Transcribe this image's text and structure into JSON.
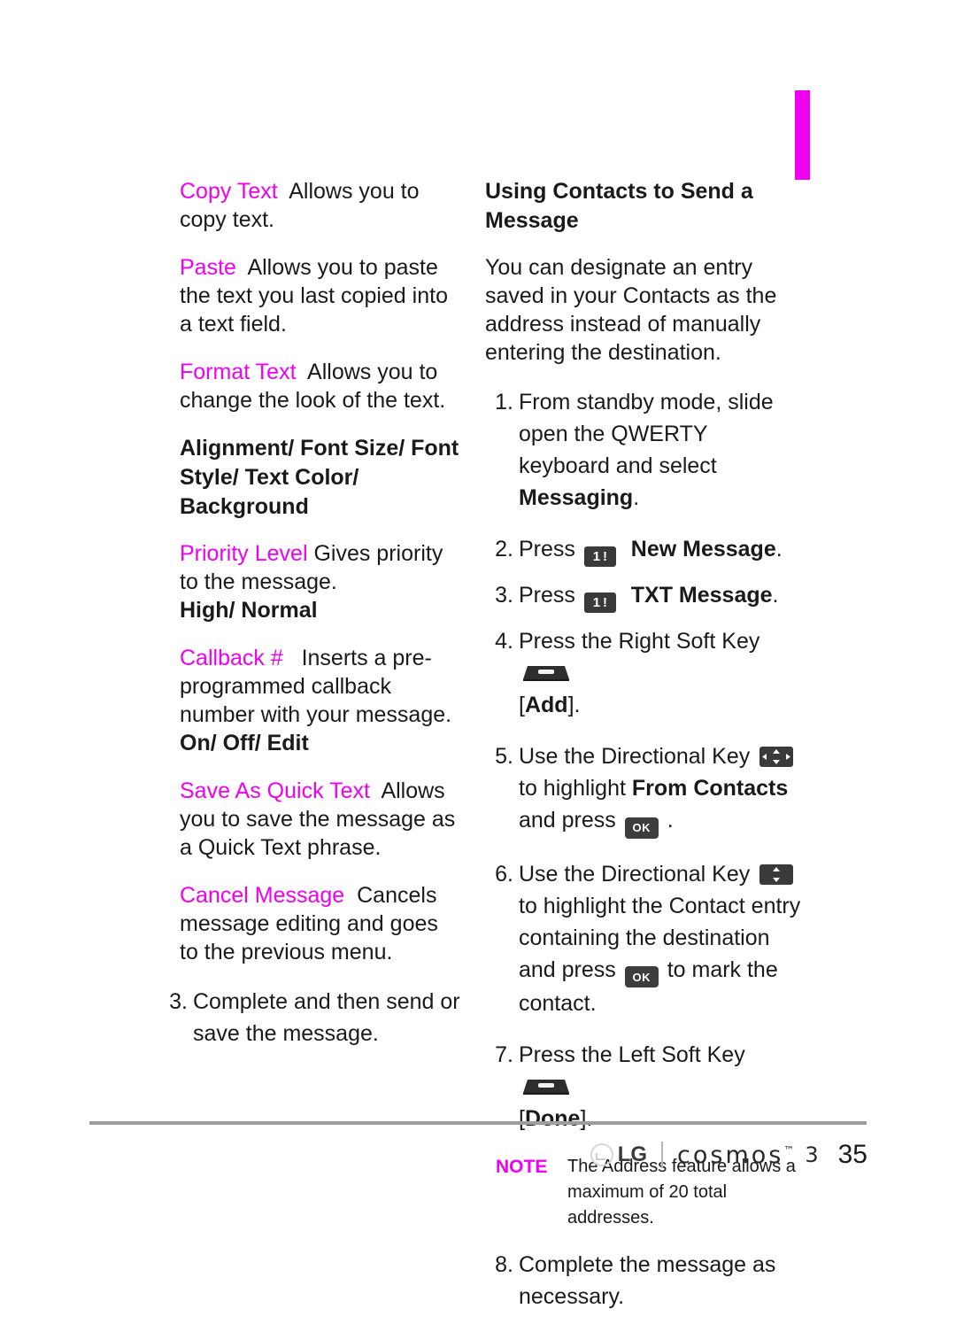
{
  "page": {
    "number": "35",
    "accent_color": "#F000F0",
    "rule_color": "#9D9D9D"
  },
  "footer": {
    "brand": "LG",
    "product": "cosmos",
    "trademark": "™",
    "model": "3",
    "page_number": "35"
  },
  "left_column": {
    "entries": [
      {
        "term": "Copy Text",
        "description": "Allows you to copy text."
      },
      {
        "term": "Paste",
        "description": "Allows you to paste the text you last copied into a text field."
      },
      {
        "term": "Format Text",
        "description": "Allows you to change the look of the text."
      }
    ],
    "subhead": "Alignment/ Font Size/ Font Style/ Text Color/ Background",
    "entries2": [
      {
        "term": "Priority Level",
        "description": "Gives priority to the message.",
        "options": "High/ Normal"
      },
      {
        "term": "Callback #",
        "description": "Inserts a pre-programmed callback number with your message.",
        "options": "On/ Off/ Edit"
      },
      {
        "term": "Save As Quick Text",
        "description": "Allows you to save the message as a Quick Text phrase.",
        "options": ""
      },
      {
        "term": "Cancel Message",
        "description": "Cancels message editing and goes to the previous menu.",
        "options": ""
      }
    ],
    "final_step": {
      "num": "3.",
      "text": "Complete and then send or save the message."
    }
  },
  "right_column": {
    "heading": "Using Contacts to Send a Message",
    "intro": "You can designate an entry saved in your Contacts as the address instead of manually entering the destination.",
    "steps": [
      {
        "num": "1.",
        "pre": "From standby mode, slide open the QWERTY keyboard and select ",
        "bold": "Messaging",
        "post": ".",
        "icon": ""
      },
      {
        "num": "2.",
        "pre": "Press ",
        "icon": "numeric-key-icon",
        "icon_label": "1",
        "bold": "New Message",
        "post": ".",
        "mid": " "
      },
      {
        "num": "3.",
        "pre": "Press ",
        "icon": "numeric-key-icon",
        "icon_label": "1",
        "bold": "TXT Message",
        "post": ".",
        "mid": " "
      },
      {
        "num": "4.",
        "pre": "Press the Right Soft Key ",
        "icon": "soft-key-icon",
        "post_pre": "[",
        "bold": "Add",
        "post": "]."
      },
      {
        "num": "5.",
        "pre": "Use the Directional Key ",
        "icon": "directional-key-4way-icon",
        "mid": " to highlight ",
        "bold": "From Contacts",
        "mid2": " and press ",
        "icon2": "ok-key-icon",
        "post": " ."
      },
      {
        "num": "6.",
        "pre": "Use the Directional Key ",
        "icon": "directional-key-updown-icon",
        "mid": " to highlight the Contact entry containing the destination and press ",
        "icon2": "ok-key-icon",
        "post": " to mark the contact."
      },
      {
        "num": "7.",
        "pre": "Press the Left Soft Key ",
        "icon": "soft-key-icon",
        "post_pre": "[",
        "bold": "Done",
        "post": "]."
      }
    ],
    "note": {
      "label": "NOTE",
      "text": "The Address feature allows a maximum of 20 total addresses."
    },
    "last_step": {
      "num": "8.",
      "text": "Complete the message as necessary."
    }
  },
  "icons": {
    "ok_key_label": "OK",
    "numeric_key_digit": "1",
    "numeric_key_symbol": "!"
  }
}
